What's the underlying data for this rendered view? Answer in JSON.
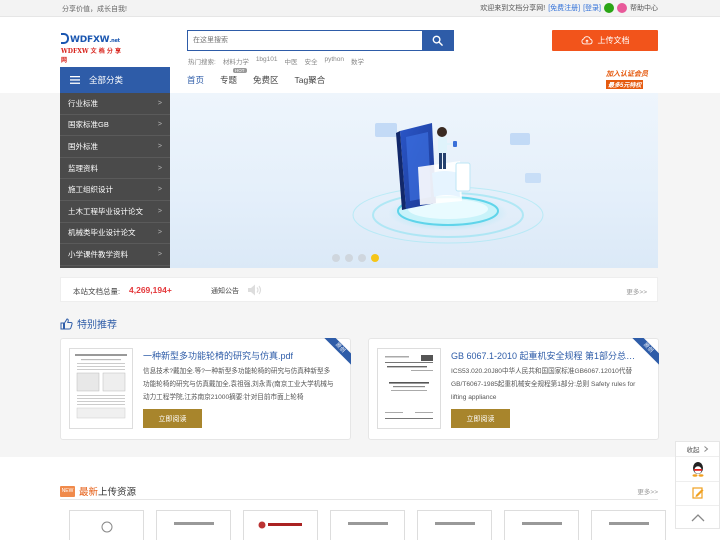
{
  "topbar": {
    "slogan": "分享价值，成长自我!",
    "welcome": "欢迎来到文档分享网!",
    "register": "[免费注册]",
    "login": "[登录]",
    "help": "帮助中心"
  },
  "header": {
    "logo_line1": "WDFXW",
    "logo_tld": ".net",
    "logo_line2": "WDFXW 文 档 分 享 网",
    "search_placeholder": "在这里搜索",
    "hot_label": "热门搜索:",
    "hot_terms": [
      "材料力学",
      "1bg101",
      "中医",
      "安全",
      "python",
      "数学"
    ],
    "upload_label": "上传文档"
  },
  "nav": {
    "all_categories": "全部分类",
    "items": [
      "首页",
      "专题",
      "免费区",
      "Tag聚合"
    ],
    "hot_badge": "HOT",
    "vip_line1": "加入认证会员",
    "vip_line2": "最多5元特权"
  },
  "categories": [
    {
      "label": "行业标准",
      "arrow": ">"
    },
    {
      "label": "国家标准GB",
      "arrow": ">"
    },
    {
      "label": "国外标准",
      "arrow": ">"
    },
    {
      "label": "监理资料",
      "arrow": ">"
    },
    {
      "label": "施工组织设计",
      "arrow": ">"
    },
    {
      "label": "土木工程毕业设计论文",
      "arrow": ">"
    },
    {
      "label": "机械类毕业设计论文",
      "arrow": ">"
    },
    {
      "label": "小学课件教学资料",
      "arrow": ">"
    }
  ],
  "banner": {
    "slide_count": 4,
    "active_slide": 4
  },
  "stats": {
    "label": "本站文档总量:",
    "count": "4,269,194+",
    "notice": "通知公告",
    "more": "更多>>"
  },
  "recommend": {
    "title": "特别推荐",
    "ribbon": "原创",
    "read_label": "立即阅读",
    "cards": [
      {
        "title": "一种新型多功能轮椅的研究与仿真.pdf",
        "desc": "信息技术?戴加全.等?一种新型多功能轮椅的研究与仿真种新型多功能轮椅的研究与仿真戴加全,袁祖强,刘永青(南京工业大学机械与动力工程学院,江苏南京21000摘要:针对目前市面上轮椅"
      },
      {
        "title": "GB 6067.1-2010 起重机安全规程 第1部分总则...",
        "desc": "ICS53.020.20J80中华人民共和国国家标准GB6067.12010代替GB/T6067-1985起重机械安全规程第1部分:总则 Safety rules for lifting appliance"
      }
    ]
  },
  "latest": {
    "badge": "NEW",
    "title_new": "最新",
    "title_rest": "上传资源",
    "more": "更多>>",
    "thumb_count": 8
  },
  "float_panel": {
    "fold_label": "收起"
  },
  "colors": {
    "brand_blue": "#2e5ca8",
    "upload_orange": "#f2541b",
    "read_gold": "#a8852c",
    "count_red": "#e4393c",
    "active_dot": "#f5c518"
  }
}
